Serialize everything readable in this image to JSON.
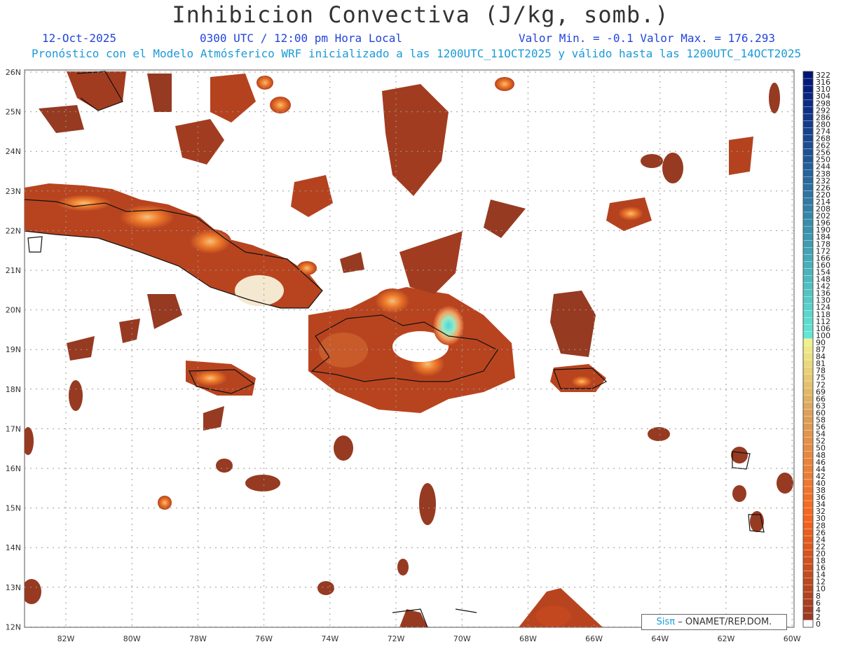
{
  "header": {
    "title": "Inhibicion Convectiva (J/kg, somb.)",
    "date": "12-Oct-2025",
    "time": "0300 UTC / 12:00 pm Hora Local",
    "minmax": "Valor Min. = -0.1  Valor Max. = 176.293",
    "forecast": "Pronóstico con el Modelo Atmósferico WRF inicializado a las 1200UTC_11OCT2025 y válido hasta las  1200UTC_14OCT2025"
  },
  "map": {
    "lat_labels": [
      "26N",
      "25N",
      "24N",
      "23N",
      "22N",
      "21N",
      "20N",
      "19N",
      "18N",
      "17N",
      "16N",
      "15N",
      "14N",
      "13N",
      "12N"
    ],
    "lon_labels": [
      "82W",
      "80W",
      "78W",
      "76W",
      "74W",
      "72W",
      "70W",
      "68W",
      "66W",
      "64W",
      "62W",
      "60W"
    ],
    "colors": {
      "cin_dark": "#963a22",
      "cin_mid": "#c4481f",
      "cin_orange": "#ee7a2a",
      "cin_light": "#f6c07a",
      "cin_cyan": "#55e0d8",
      "coast": "#111111"
    }
  },
  "colorbar": {
    "labels": [
      "322",
      "316",
      "310",
      "304",
      "298",
      "292",
      "286",
      "280",
      "274",
      "268",
      "262",
      "256",
      "250",
      "244",
      "238",
      "232",
      "226",
      "220",
      "214",
      "208",
      "202",
      "196",
      "190",
      "184",
      "178",
      "172",
      "166",
      "160",
      "154",
      "148",
      "142",
      "136",
      "130",
      "124",
      "118",
      "112",
      "106",
      "100",
      "90",
      "87",
      "84",
      "81",
      "78",
      "75",
      "72",
      "69",
      "66",
      "63",
      "60",
      "58",
      "56",
      "54",
      "52",
      "50",
      "48",
      "46",
      "44",
      "42",
      "40",
      "38",
      "36",
      "34",
      "32",
      "30",
      "28",
      "26",
      "24",
      "22",
      "20",
      "18",
      "16",
      "14",
      "12",
      "10",
      "8",
      "6",
      "4",
      "2",
      "0"
    ]
  },
  "credit": {
    "brand": "Sisπ",
    "rest": "– ONAMET/REP.DOM."
  }
}
